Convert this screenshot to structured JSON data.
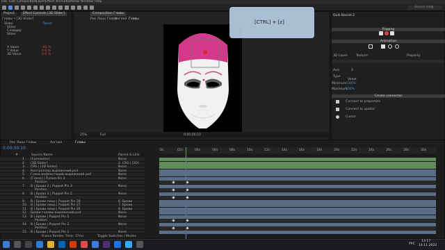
{
  "menu": [
    "File",
    "Edit",
    "Composition",
    "Layer",
    "Effect",
    "Animation",
    "View",
    "Window",
    "Help"
  ],
  "left_panel": {
    "tab1": "Project",
    "tab2": "Effect Controls",
    "tab2_detail": "[3D Slider]",
    "breadcrumb": "Главы • [3D Slider]",
    "items": [
      {
        "label": "Slider",
        "value": ""
      },
      {
        "label": "Slider",
        "value": "Reset"
      },
      {
        "label": "Слайдер",
        "value": ""
      },
      {
        "label": "Slider",
        "value": ""
      }
    ],
    "props": [
      {
        "label": "X Value",
        "value": "-85 %"
      },
      {
        "label": "Y Value",
        "value": "0.0 %"
      },
      {
        "label": "3D Value",
        "value": "0.0 %"
      }
    ]
  },
  "comp_panel": {
    "tab": "Composition",
    "tab_name": "Главы",
    "crumbs": [
      "Рис Лицо Главы",
      "Англия",
      "Главы"
    ],
    "zoom": "25%",
    "quality": "Full",
    "timecode": "0:00:00:10"
  },
  "overlay": {
    "text": "[CTRL] + [z]"
  },
  "right_panel": {
    "title": "Duik Bassel.2",
    "sections": [
      "Rigging",
      "Animation",
      "Connect"
    ],
    "tabs": [
      "3D Layer",
      "Texture",
      "Property"
    ],
    "fields": [
      {
        "label": "Axis",
        "value": "X"
      },
      {
        "label": "Type",
        "value": "Value"
      },
      {
        "label": "Minimum",
        "value": "-100%"
      },
      {
        "label": "Maximum",
        "value": "100%"
      }
    ],
    "section2": "Create connector",
    "options": [
      "Connect to properties",
      "Connect to spatial",
      "Cursor"
    ],
    "search_placeholder": "Search Help"
  },
  "timeline": {
    "tabs": [
      "Рис Лицо Главы",
      "Англия",
      "Главы"
    ],
    "timecode": "0:00:00:10",
    "columns": [
      "#",
      "Source Name",
      "Parent & Link"
    ],
    "rows": [
      {
        "num": "1",
        "name": "[Connector]",
        "mode": "None",
        "green": true
      },
      {
        "num": "2",
        "name": "[3D Slider]",
        "mode": "2. CRS | [3D]",
        "green": true
      },
      {
        "num": "3",
        "name": "CRS | [3D Slider]",
        "mode": "None",
        "green": true
      },
      {
        "num": "4",
        "name": "Контроллер выражений.psd",
        "mode": "None",
        "green": false
      },
      {
        "num": "5",
        "name": "Глаза инфекстаций выражений.psd",
        "mode": "None",
        "green": false
      },
      {
        "num": "6",
        "name": "[Глаза] | Пупил Pin 4",
        "mode": "None",
        "green": false
      },
      {
        "num": "",
        "name": "Position",
        "mode": "",
        "green": false
      },
      {
        "num": "7",
        "name": "B | Брови 2 | Puppet Pin 3",
        "mode": "None",
        "green": false
      },
      {
        "num": "",
        "name": "Position",
        "mode": "",
        "green": false
      },
      {
        "num": "8",
        "name": "B | Брови 2 | Puppet Pin 2",
        "mode": "None",
        "green": false
      },
      {
        "num": "",
        "name": "Position",
        "mode": "",
        "green": false
      },
      {
        "num": "9",
        "name": "B | Брови лицо | Puppet Pin 28",
        "mode": "6. Брови",
        "green": false
      },
      {
        "num": "10",
        "name": "B | Брови лицо | Puppet Pin 27",
        "mode": "7. Брови",
        "green": false
      },
      {
        "num": "11",
        "name": "B | Брови лицо | Puppet Pin 26",
        "mode": "8. Брови",
        "green": false
      },
      {
        "num": "12",
        "name": "Брови головы выражений.psd",
        "mode": "None",
        "green": false
      },
      {
        "num": "13",
        "name": "B | Брови | Puppet Pin 5",
        "mode": "None",
        "green": false
      },
      {
        "num": "",
        "name": "Position",
        "mode": "",
        "green": false
      },
      {
        "num": "14",
        "name": "B | Брови | Puppet Pin 2",
        "mode": "None",
        "green": false
      },
      {
        "num": "",
        "name": "Position",
        "mode": "",
        "green": false
      },
      {
        "num": "15",
        "name": "B | Брови | Puppet Pin 1",
        "mode": "None",
        "green": false
      }
    ],
    "ruler": [
      "0s",
      "02s",
      "04s",
      "06s",
      "08s",
      "10s",
      "12s",
      "14s",
      "16s",
      "18s",
      "20s",
      "22s",
      "24s",
      "26s",
      "28s",
      "30s"
    ],
    "footer": "Frame Render Time: 37ms",
    "footer2": "Toggle Switches / Modes"
  },
  "taskbar": {
    "time": "13:17",
    "date": "14.11.2022",
    "lang": "РУС"
  }
}
